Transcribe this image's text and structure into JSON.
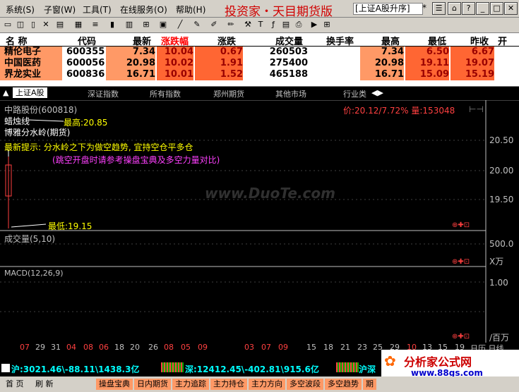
{
  "menu": {
    "items": [
      "系统(S)",
      "子窗(W)",
      "工具(T)",
      "在线服务(O)",
      "帮助(H)"
    ],
    "app_title": "投资家・天目期货版",
    "market_selector": "[上证A股升序]",
    "star": "*"
  },
  "quote_table": {
    "headers": [
      "名 称",
      "代码",
      "最新",
      "涨跌幅",
      "涨跌",
      "成交量",
      "换手率",
      "最高",
      "最低",
      "昨收",
      "开"
    ],
    "rows": [
      {
        "name": "精伦电子",
        "code": "600355",
        "latest": "7.34",
        "change_pct": "10.04",
        "change": "0.67",
        "volume": "260503",
        "turnover": "",
        "high": "7.34",
        "low": "6.50",
        "prev_close": "6.67"
      },
      {
        "name": "中国医药",
        "code": "600056",
        "latest": "20.98",
        "change_pct": "10.02",
        "change": "1.91",
        "volume": "275400",
        "turnover": "",
        "high": "20.98",
        "low": "19.11",
        "prev_close": "19.07"
      },
      {
        "name": "界龙实业",
        "code": "600836",
        "latest": "16.71",
        "change_pct": "10.01",
        "change": "1.52",
        "volume": "465188",
        "turnover": "",
        "high": "16.71",
        "low": "15.09",
        "prev_close": "15.19"
      }
    ]
  },
  "tabs": [
    "上证A股",
    "深证指数",
    "所有指数",
    "郑州期货",
    "其他市场",
    "行业类"
  ],
  "chart": {
    "stock_title": "中路股份(600818)",
    "candle_label": "蜡烛线",
    "high_label": "最高:20.85",
    "indicator_label": "博雅分水岭(期货)",
    "tip_text": "最新提示: 分水岭之下为做空趋势, 宜持空仓平多仓",
    "tip_sub": "(跳空开盘时请参考操盘宝典及多空力量对比)",
    "low_label": "最低:19.15",
    "price_info": "价:20.12/7.72% 量:153048",
    "watermark": "www.DuoTe.com",
    "y_ticks": [
      "20.50",
      "20.00",
      "19.50"
    ],
    "volume_label": "成交量(5,10)",
    "volume_tick": "500.0",
    "volume_unit": "X万",
    "macd_label": "MACD(12,26,9)",
    "macd_tick": "1.00",
    "macd_unit": "/百万",
    "dates": [
      "07",
      "29",
      "31",
      "04",
      "08",
      "06",
      "18",
      "20",
      "26",
      "08",
      "05",
      "09",
      "03",
      "07",
      "09",
      "15",
      "18",
      "21",
      "23",
      "25",
      "29",
      "10",
      "13",
      "15",
      "19"
    ],
    "calendar_label": "日历 日线"
  },
  "status": {
    "sh": "沪:3021.46\\-88.11\\1438.3亿",
    "sz": "深:12412.45\\-402.81\\915.6亿",
    "sh2": "沪深",
    "logo": "分析家公式网",
    "logo_url": "www.88gs.com"
  },
  "nav": [
    "首 页",
    "刷 新",
    "操盘宝典",
    "日内期货",
    "主力追踪",
    "主力持仓",
    "主力方向",
    "多空波段",
    "多空趋势",
    "期"
  ],
  "colors": {
    "up_red": "#ff4040",
    "yellow": "#ffff00",
    "magenta": "#ff40ff",
    "cyan": "#00ffff",
    "quote_bg": "#ff9966"
  }
}
